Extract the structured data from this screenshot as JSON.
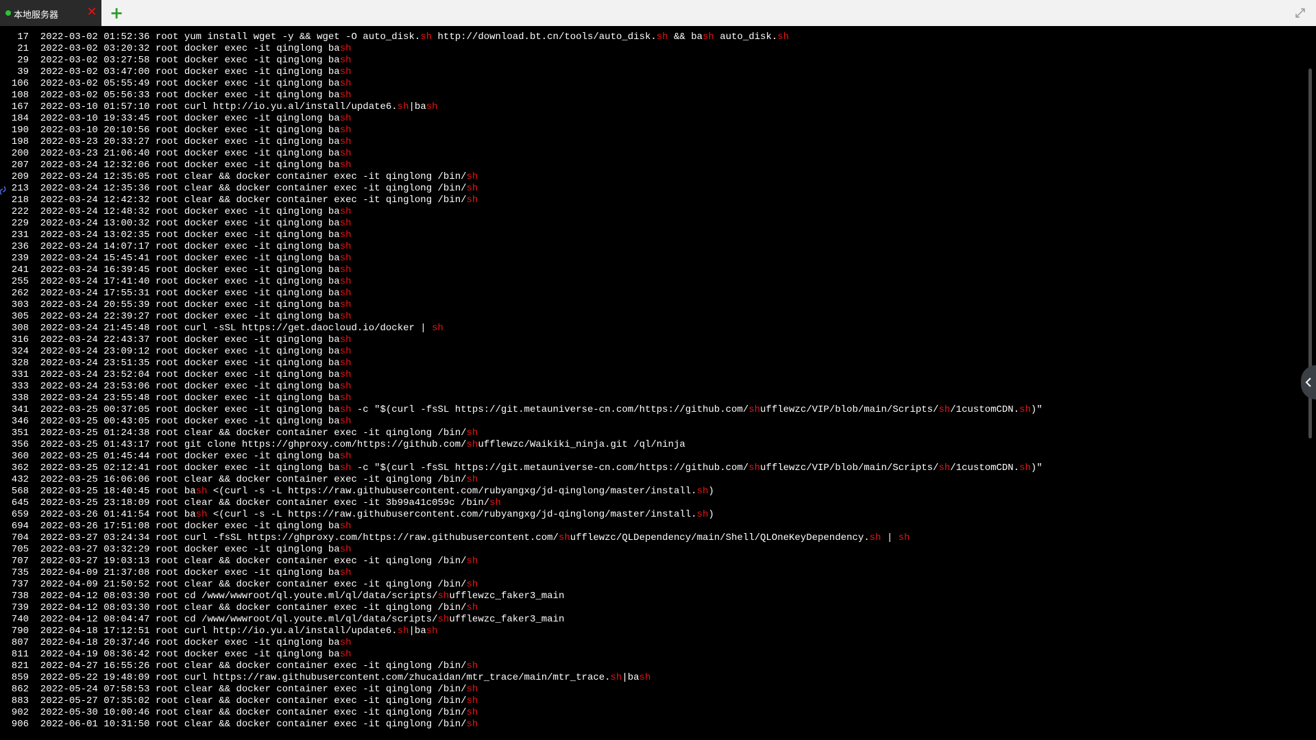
{
  "tabs": [
    {
      "label": "本地服务器",
      "status_color": "#2ec13a",
      "close_icon": "close-icon"
    }
  ],
  "add_tab_label": "+",
  "highlight_color": "#e81414",
  "history": [
    {
      "num": "17",
      "date": "2022-03-02",
      "time": "01:52:36",
      "user": "root",
      "cmd": "yum install wget -y && wget -O auto_disk.sh http://download.bt.cn/tools/auto_disk.sh && bash auto_disk.sh"
    },
    {
      "num": "21",
      "date": "2022-03-02",
      "time": "03:20:32",
      "user": "root",
      "cmd": "docker exec -it qinglong bash"
    },
    {
      "num": "29",
      "date": "2022-03-02",
      "time": "03:27:58",
      "user": "root",
      "cmd": "docker exec -it qinglong bash"
    },
    {
      "num": "39",
      "date": "2022-03-02",
      "time": "03:47:00",
      "user": "root",
      "cmd": "docker exec -it qinglong bash"
    },
    {
      "num": "106",
      "date": "2022-03-02",
      "time": "05:55:49",
      "user": "root",
      "cmd": "docker exec -it qinglong bash"
    },
    {
      "num": "108",
      "date": "2022-03-02",
      "time": "05:56:33",
      "user": "root",
      "cmd": "docker exec -it qinglong bash"
    },
    {
      "num": "167",
      "date": "2022-03-10",
      "time": "01:57:10",
      "user": "root",
      "cmd": "curl http://io.yu.al/install/update6.sh|bash"
    },
    {
      "num": "184",
      "date": "2022-03-10",
      "time": "19:33:45",
      "user": "root",
      "cmd": "docker exec -it qinglong bash"
    },
    {
      "num": "190",
      "date": "2022-03-10",
      "time": "20:10:56",
      "user": "root",
      "cmd": "docker exec -it qinglong bash"
    },
    {
      "num": "198",
      "date": "2022-03-23",
      "time": "20:33:27",
      "user": "root",
      "cmd": "docker exec -it qinglong bash"
    },
    {
      "num": "200",
      "date": "2022-03-23",
      "time": "21:06:40",
      "user": "root",
      "cmd": "docker exec -it qinglong bash"
    },
    {
      "num": "207",
      "date": "2022-03-24",
      "time": "12:32:06",
      "user": "root",
      "cmd": "docker exec -it qinglong bash"
    },
    {
      "num": "209",
      "date": "2022-03-24",
      "time": "12:35:05",
      "user": "root",
      "cmd": "clear && docker container exec -it qinglong /bin/sh"
    },
    {
      "num": "213",
      "date": "2022-03-24",
      "time": "12:35:36",
      "user": "root",
      "cmd": "clear && docker container exec -it qinglong /bin/sh"
    },
    {
      "num": "218",
      "date": "2022-03-24",
      "time": "12:42:32",
      "user": "root",
      "cmd": "clear && docker container exec -it qinglong /bin/sh"
    },
    {
      "num": "222",
      "date": "2022-03-24",
      "time": "12:48:32",
      "user": "root",
      "cmd": "docker exec -it qinglong bash"
    },
    {
      "num": "229",
      "date": "2022-03-24",
      "time": "13:00:32",
      "user": "root",
      "cmd": "docker exec -it qinglong bash"
    },
    {
      "num": "231",
      "date": "2022-03-24",
      "time": "13:02:35",
      "user": "root",
      "cmd": "docker exec -it qinglong bash"
    },
    {
      "num": "236",
      "date": "2022-03-24",
      "time": "14:07:17",
      "user": "root",
      "cmd": "docker exec -it qinglong bash"
    },
    {
      "num": "239",
      "date": "2022-03-24",
      "time": "15:45:41",
      "user": "root",
      "cmd": "docker exec -it qinglong bash"
    },
    {
      "num": "241",
      "date": "2022-03-24",
      "time": "16:39:45",
      "user": "root",
      "cmd": "docker exec -it qinglong bash"
    },
    {
      "num": "255",
      "date": "2022-03-24",
      "time": "17:41:40",
      "user": "root",
      "cmd": "docker exec -it qinglong bash"
    },
    {
      "num": "262",
      "date": "2022-03-24",
      "time": "17:55:31",
      "user": "root",
      "cmd": "docker exec -it qinglong bash"
    },
    {
      "num": "303",
      "date": "2022-03-24",
      "time": "20:55:39",
      "user": "root",
      "cmd": "docker exec -it qinglong bash"
    },
    {
      "num": "305",
      "date": "2022-03-24",
      "time": "22:39:27",
      "user": "root",
      "cmd": "docker exec -it qinglong bash"
    },
    {
      "num": "308",
      "date": "2022-03-24",
      "time": "21:45:48",
      "user": "root",
      "cmd": "curl -sSL https://get.daocloud.io/docker | sh"
    },
    {
      "num": "316",
      "date": "2022-03-24",
      "time": "22:43:37",
      "user": "root",
      "cmd": "docker exec -it qinglong bash"
    },
    {
      "num": "324",
      "date": "2022-03-24",
      "time": "23:09:12",
      "user": "root",
      "cmd": "docker exec -it qinglong bash"
    },
    {
      "num": "328",
      "date": "2022-03-24",
      "time": "23:51:35",
      "user": "root",
      "cmd": "docker exec -it qinglong bash"
    },
    {
      "num": "331",
      "date": "2022-03-24",
      "time": "23:52:04",
      "user": "root",
      "cmd": "docker exec -it qinglong bash"
    },
    {
      "num": "333",
      "date": "2022-03-24",
      "time": "23:53:06",
      "user": "root",
      "cmd": "docker exec -it qinglong bash"
    },
    {
      "num": "338",
      "date": "2022-03-24",
      "time": "23:55:48",
      "user": "root",
      "cmd": "docker exec -it qinglong bash"
    },
    {
      "num": "341",
      "date": "2022-03-25",
      "time": "00:37:05",
      "user": "root",
      "cmd": "docker exec -it qinglong bash -c \"$(curl -fsSL https://git.metauniverse-cn.com/https://github.com/shufflewzc/VIP/blob/main/Scripts/sh/1customCDN.sh)\""
    },
    {
      "num": "346",
      "date": "2022-03-25",
      "time": "00:43:05",
      "user": "root",
      "cmd": "docker exec -it qinglong bash"
    },
    {
      "num": "351",
      "date": "2022-03-25",
      "time": "01:24:38",
      "user": "root",
      "cmd": "clear && docker container exec -it qinglong /bin/sh"
    },
    {
      "num": "356",
      "date": "2022-03-25",
      "time": "01:43:17",
      "user": "root",
      "cmd": "git clone https://ghproxy.com/https://github.com/shufflewzc/Waikiki_ninja.git /ql/ninja"
    },
    {
      "num": "360",
      "date": "2022-03-25",
      "time": "01:45:44",
      "user": "root",
      "cmd": "docker exec -it qinglong bash"
    },
    {
      "num": "362",
      "date": "2022-03-25",
      "time": "02:12:41",
      "user": "root",
      "cmd": "docker exec -it qinglong bash -c \"$(curl -fsSL https://git.metauniverse-cn.com/https://github.com/shufflewzc/VIP/blob/main/Scripts/sh/1customCDN.sh)\""
    },
    {
      "num": "432",
      "date": "2022-03-25",
      "time": "16:06:06",
      "user": "root",
      "cmd": "clear && docker container exec -it qinglong /bin/sh"
    },
    {
      "num": "568",
      "date": "2022-03-25",
      "time": "18:40:45",
      "user": "root",
      "cmd": "bash <(curl -s -L https://raw.githubusercontent.com/rubyangxg/jd-qinglong/master/install.sh)"
    },
    {
      "num": "645",
      "date": "2022-03-25",
      "time": "23:18:09",
      "user": "root",
      "cmd": "clear && docker container exec -it 3b99a41c059c /bin/sh"
    },
    {
      "num": "659",
      "date": "2022-03-26",
      "time": "01:41:54",
      "user": "root",
      "cmd": "bash <(curl -s -L https://raw.githubusercontent.com/rubyangxg/jd-qinglong/master/install.sh)"
    },
    {
      "num": "694",
      "date": "2022-03-26",
      "time": "17:51:08",
      "user": "root",
      "cmd": "docker exec -it qinglong bash"
    },
    {
      "num": "704",
      "date": "2022-03-27",
      "time": "03:24:34",
      "user": "root",
      "cmd": "curl -fsSL https://ghproxy.com/https://raw.githubusercontent.com/shufflewzc/QLDependency/main/Shell/QLOneKeyDependency.sh | sh"
    },
    {
      "num": "705",
      "date": "2022-03-27",
      "time": "03:32:29",
      "user": "root",
      "cmd": "docker exec -it qinglong bash"
    },
    {
      "num": "707",
      "date": "2022-03-27",
      "time": "19:03:13",
      "user": "root",
      "cmd": "clear && docker container exec -it qinglong /bin/sh"
    },
    {
      "num": "735",
      "date": "2022-04-09",
      "time": "21:37:08",
      "user": "root",
      "cmd": "docker exec -it qinglong bash"
    },
    {
      "num": "737",
      "date": "2022-04-09",
      "time": "21:50:52",
      "user": "root",
      "cmd": "clear && docker container exec -it qinglong /bin/sh"
    },
    {
      "num": "738",
      "date": "2022-04-12",
      "time": "08:03:30",
      "user": "root",
      "cmd": "cd /www/wwwroot/ql.youte.ml/ql/data/scripts/shufflewzc_faker3_main"
    },
    {
      "num": "739",
      "date": "2022-04-12",
      "time": "08:03:30",
      "user": "root",
      "cmd": "clear && docker container exec -it qinglong /bin/sh"
    },
    {
      "num": "740",
      "date": "2022-04-12",
      "time": "08:04:47",
      "user": "root",
      "cmd": "cd /www/wwwroot/ql.youte.ml/ql/data/scripts/shufflewzc_faker3_main"
    },
    {
      "num": "790",
      "date": "2022-04-18",
      "time": "17:12:51",
      "user": "root",
      "cmd": "curl http://io.yu.al/install/update6.sh|bash"
    },
    {
      "num": "807",
      "date": "2022-04-18",
      "time": "20:37:46",
      "user": "root",
      "cmd": "docker exec -it qinglong bash"
    },
    {
      "num": "811",
      "date": "2022-04-19",
      "time": "08:36:42",
      "user": "root",
      "cmd": "docker exec -it qinglong bash"
    },
    {
      "num": "821",
      "date": "2022-04-27",
      "time": "16:55:26",
      "user": "root",
      "cmd": "clear && docker container exec -it qinglong /bin/sh"
    },
    {
      "num": "859",
      "date": "2022-05-22",
      "time": "19:48:09",
      "user": "root",
      "cmd": "curl https://raw.githubusercontent.com/zhucaidan/mtr_trace/main/mtr_trace.sh|bash"
    },
    {
      "num": "862",
      "date": "2022-05-24",
      "time": "07:58:53",
      "user": "root",
      "cmd": "clear && docker container exec -it qinglong /bin/sh"
    },
    {
      "num": "883",
      "date": "2022-05-27",
      "time": "07:35:02",
      "user": "root",
      "cmd": "clear && docker container exec -it qinglong /bin/sh"
    },
    {
      "num": "902",
      "date": "2022-05-30",
      "time": "10:00:46",
      "user": "root",
      "cmd": "clear && docker container exec -it qinglong /bin/sh"
    },
    {
      "num": "906",
      "date": "2022-06-01",
      "time": "10:31:50",
      "user": "root",
      "cmd": "clear && docker container exec -it qinglong /bin/sh"
    }
  ]
}
